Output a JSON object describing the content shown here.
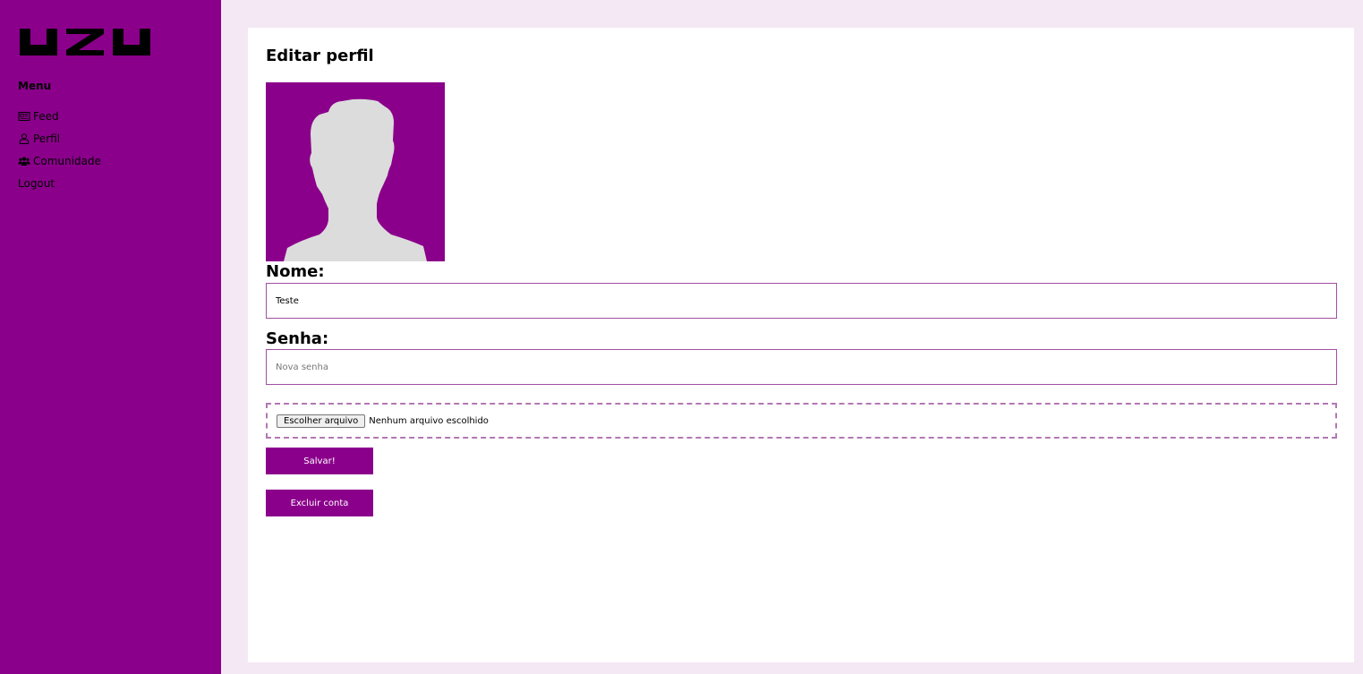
{
  "brand": {
    "logo_text": "UZU",
    "accent_color": "#8b008b"
  },
  "sidebar": {
    "menu_title": "Menu",
    "items": [
      {
        "label": "Feed",
        "icon": "newspaper-icon"
      },
      {
        "label": "Perfil",
        "icon": "user-icon"
      },
      {
        "label": "Comunidade",
        "icon": "users-icon"
      },
      {
        "label": "Logout",
        "icon": ""
      }
    ]
  },
  "main": {
    "title": "Editar perfil",
    "avatar": {
      "icon": "default-avatar-silhouette"
    },
    "name_field": {
      "label": "Nome:",
      "value": "Teste"
    },
    "password_field": {
      "label": "Senha:",
      "placeholder": "Nova senha",
      "value": ""
    },
    "file_input": {
      "button_label": "Escolher arquivo",
      "status_text": "Nenhum arquivo escolhido"
    },
    "save_button": "Salvar!",
    "delete_button": "Excluir conta"
  }
}
